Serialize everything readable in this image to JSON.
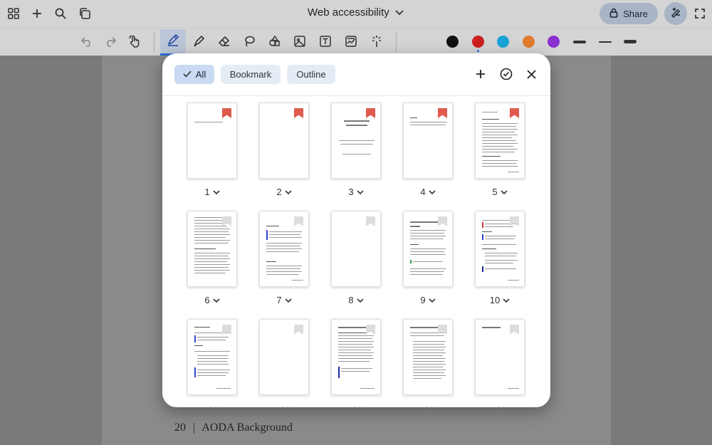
{
  "header": {
    "title": "Web accessibility",
    "share_label": "Share"
  },
  "colors": {
    "swatches": [
      "#111111",
      "#cc1f1f",
      "#1aa3d6",
      "#e07a2e",
      "#8a2fd0"
    ],
    "accent": "#2c6dd8",
    "bookmark_on": "#e05a4e",
    "bookmark_off": "#dcdcdc"
  },
  "toolbar": {
    "tools": [
      "undo-icon",
      "redo-icon",
      "touch-icon",
      "pen-icon",
      "highlighter-icon",
      "eraser-icon",
      "lasso-icon",
      "shapes-icon",
      "image-icon",
      "text-icon",
      "chart-image-icon",
      "laser-icon"
    ],
    "selected_tool": "pen-icon"
  },
  "modal": {
    "filters": [
      {
        "label": "All",
        "selected": true
      },
      {
        "label": "Bookmark",
        "selected": false
      },
      {
        "label": "Outline",
        "selected": false
      }
    ],
    "pages": [
      {
        "number": "1",
        "bookmarked": true
      },
      {
        "number": "2",
        "bookmarked": true
      },
      {
        "number": "3",
        "bookmarked": true
      },
      {
        "number": "4",
        "bookmarked": true
      },
      {
        "number": "5",
        "bookmarked": true
      },
      {
        "number": "6",
        "bookmarked": false
      },
      {
        "number": "7",
        "bookmarked": false
      },
      {
        "number": "8",
        "bookmarked": false
      },
      {
        "number": "9",
        "bookmarked": false
      },
      {
        "number": "10",
        "bookmarked": false
      },
      {
        "number": "",
        "bookmarked": false
      },
      {
        "number": "",
        "bookmarked": false
      },
      {
        "number": "",
        "bookmarked": false
      },
      {
        "number": "",
        "bookmarked": false
      },
      {
        "number": "",
        "bookmarked": false
      }
    ]
  },
  "document": {
    "footer_page": "20",
    "footer_separator": "|",
    "footer_title": "AODA Background"
  }
}
